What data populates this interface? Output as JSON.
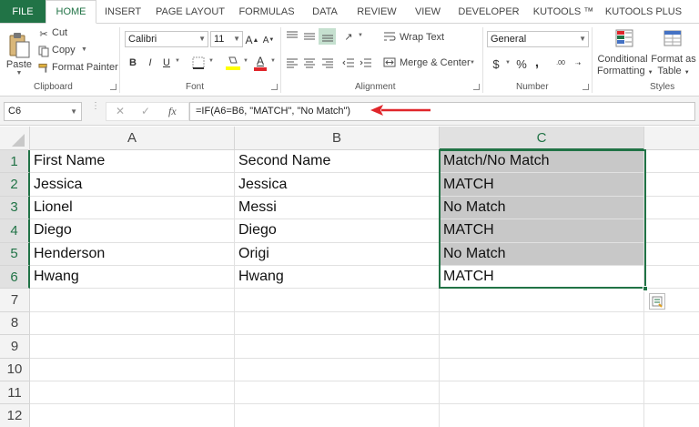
{
  "ribbon_tabs": [
    "FILE",
    "HOME",
    "INSERT",
    "PAGE LAYOUT",
    "FORMULAS",
    "DATA",
    "REVIEW",
    "VIEW",
    "DEVELOPER",
    "KUTOOLS ™",
    "KUTOOLS PLUS"
  ],
  "clipboard": {
    "paste": "Paste",
    "cut": "Cut",
    "copy": "Copy",
    "format_painter": "Format Painter",
    "group_label": "Clipboard"
  },
  "font": {
    "family": "Calibri",
    "size": "11",
    "bold": "B",
    "italic": "I",
    "underline": "U",
    "grow": "A",
    "shrink": "A",
    "color_letter": "A",
    "group_label": "Font"
  },
  "alignment": {
    "wrap_text": "Wrap Text",
    "merge_center": "Merge & Center",
    "group_label": "Alignment"
  },
  "number": {
    "format": "General",
    "currency": "$",
    "percent": "%",
    "comma": ",",
    "inc_decimal": ".00",
    "group_label": "Number"
  },
  "styles": {
    "conditional_line1": "Conditional",
    "conditional_line2": "Formatting",
    "table_line1": "Format as",
    "table_line2": "Table",
    "group_label": "Styles"
  },
  "formula_bar": {
    "name_box": "C6",
    "cancel": "✕",
    "enter": "✓",
    "fx": "fx",
    "formula": "=IF(A6=B6, \"MATCH\", \"No Match\")"
  },
  "columns": [
    "A",
    "B",
    "C"
  ],
  "rows": [
    "1",
    "2",
    "3",
    "4",
    "5",
    "6",
    "7",
    "8",
    "9",
    "10",
    "11",
    "12"
  ],
  "cells": [
    [
      "First Name",
      "Second Name",
      "Match/No Match"
    ],
    [
      "Jessica",
      "Jessica",
      "MATCH"
    ],
    [
      "Lionel",
      "Messi",
      "No Match"
    ],
    [
      "Diego",
      "Diego",
      "MATCH"
    ],
    [
      "Henderson",
      "Origi",
      "No Match"
    ],
    [
      "Hwang",
      "Hwang",
      "MATCH"
    ]
  ],
  "colors": {
    "accent": "#217346",
    "arrow": "#e0262b",
    "shaded": "#c8c8c8"
  }
}
